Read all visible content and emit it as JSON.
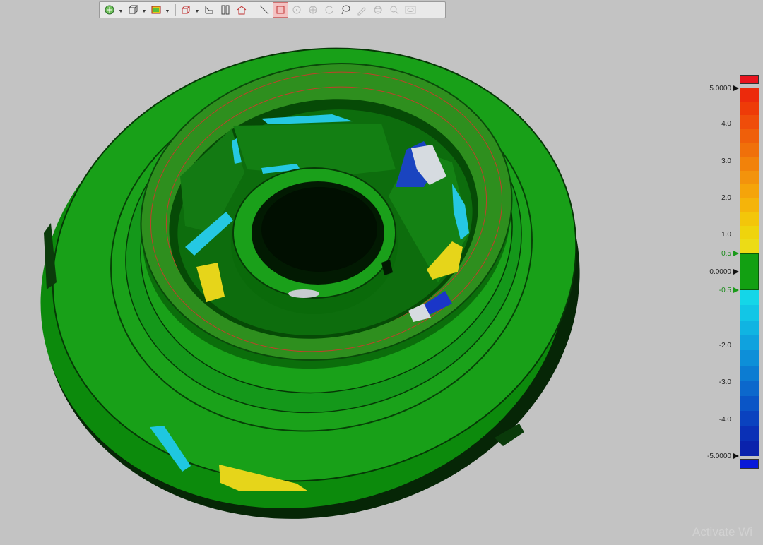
{
  "toolbar": {
    "buttons": [
      {
        "name": "view-orientation-icon",
        "dropdown": true
      },
      {
        "name": "box-view-icon",
        "dropdown": true
      },
      {
        "name": "color-map-icon",
        "dropdown": true
      },
      {
        "name": "cube-wireframe-icon",
        "dropdown": true
      },
      {
        "name": "section-plane-icon",
        "dropdown": false
      },
      {
        "name": "split-view-icon",
        "dropdown": false
      },
      {
        "name": "home-view-icon",
        "dropdown": false
      },
      {
        "name": "line-tool-icon",
        "dropdown": false
      },
      {
        "name": "select-region-icon",
        "dropdown": false,
        "active": true
      },
      {
        "name": "point-target-icon",
        "dropdown": false,
        "disabled": true
      },
      {
        "name": "center-target-icon",
        "dropdown": false,
        "disabled": true
      },
      {
        "name": "rotate-icon",
        "dropdown": false,
        "disabled": true
      },
      {
        "name": "lasso-icon",
        "dropdown": false
      },
      {
        "name": "annotate-icon",
        "dropdown": false,
        "disabled": true
      },
      {
        "name": "sphere-icon",
        "dropdown": false,
        "disabled": true
      },
      {
        "name": "inspect-icon",
        "dropdown": false,
        "disabled": true
      },
      {
        "name": "eye-icon",
        "dropdown": false,
        "disabled": true
      }
    ]
  },
  "legend": {
    "top_color": "#e8141e",
    "bottom_color": "#0818d8",
    "max_label": "5.0000",
    "zero_label": "0.0000",
    "min_label": "-5.0000",
    "upper_tol_label": "0.5",
    "lower_tol_label": "-0.5",
    "tick_labels": [
      "4.0",
      "3.0",
      "2.0",
      "1.0",
      "-2.0",
      "-3.0",
      "-4.0"
    ],
    "positive_colors": [
      "#ec2a0c",
      "#ee3b08",
      "#ef4d0a",
      "#ef5f0a",
      "#f0700a",
      "#f2820a",
      "#f3930c",
      "#f5a40a",
      "#f5b40a",
      "#f3c60a",
      "#efd40c",
      "#ecdc16"
    ],
    "tolerance_color": "#12a012",
    "negative_colors": [
      "#14d6e8",
      "#12c6e6",
      "#10b4e2",
      "#0fa2de",
      "#0d8fd8",
      "#0c7cd2",
      "#0c68cc",
      "#0a55c6",
      "#0a42bf",
      "#0a30b6",
      "#0a22ac"
    ]
  },
  "watermark": "Activate Wi"
}
